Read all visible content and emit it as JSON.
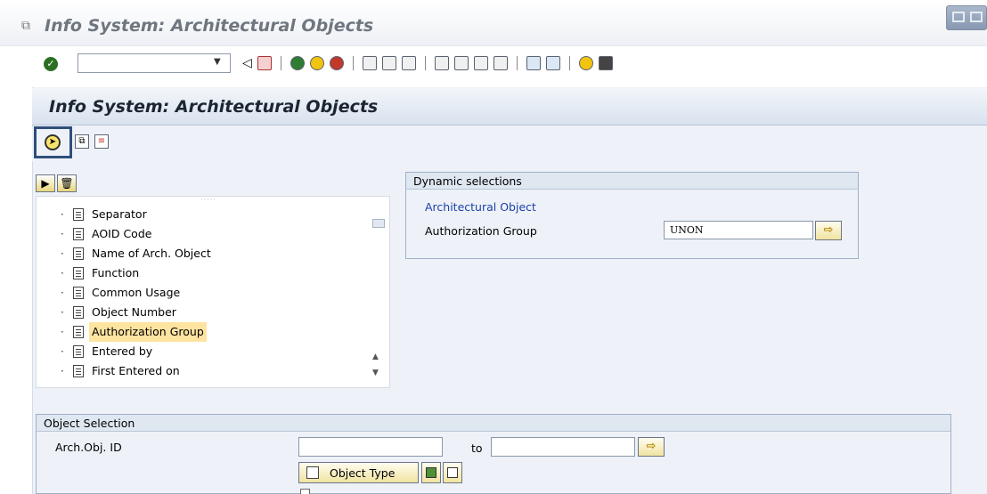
{
  "window": {
    "title": "Info System: Architectural Objects"
  },
  "toolbar": {
    "command_field_value": "",
    "icons": [
      "enter-icon",
      "back-icon",
      "save-icon",
      "back-green-icon",
      "exit-icon",
      "cancel-icon",
      "print-icon",
      "find-icon",
      "find-next-icon",
      "first-page-icon",
      "previous-page-icon",
      "next-page-icon",
      "last-page-icon",
      "new-session-icon",
      "shortcut-icon",
      "help-icon",
      "customize-layout-icon"
    ]
  },
  "main": {
    "title": "Info System: Architectural Objects",
    "app_toolbar": [
      "execute-icon",
      "get-variant-icon",
      "dynamic-selections-icon"
    ]
  },
  "tree": {
    "items": [
      {
        "label": "Separator",
        "selected": false
      },
      {
        "label": "AOID Code",
        "selected": false
      },
      {
        "label": "Name of Arch. Object",
        "selected": false
      },
      {
        "label": "Function",
        "selected": false
      },
      {
        "label": "Common Usage",
        "selected": false
      },
      {
        "label": "Object Number",
        "selected": false
      },
      {
        "label": "Authorization Group",
        "selected": true
      },
      {
        "label": "Entered by",
        "selected": false
      },
      {
        "label": "First Entered on",
        "selected": false
      }
    ]
  },
  "dynamic_selections": {
    "header": "Dynamic selections",
    "group": "Architectural Object",
    "field_label": "Authorization Group",
    "field_value": "UNON"
  },
  "object_selection": {
    "header": "Object Selection",
    "field_label": "Arch.Obj. ID",
    "to_label": "to",
    "from_value": "",
    "to_value": "",
    "object_type_button": "Object Type"
  }
}
